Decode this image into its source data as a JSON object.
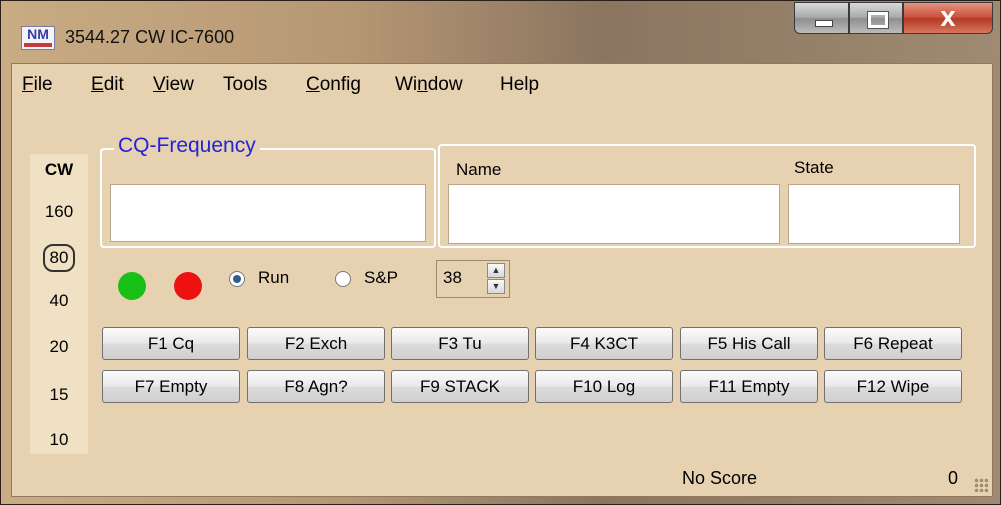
{
  "window": {
    "title": "3544.27 CW IC-7600",
    "app_icon_text": "NM",
    "controls": {
      "minimize": "minimize",
      "maximize": "maximize",
      "close": "X"
    }
  },
  "menu": [
    "File",
    "Edit",
    "View",
    "Tools",
    "Config",
    "Window",
    "Help"
  ],
  "bands": {
    "mode": "CW",
    "items": [
      "160",
      "80",
      "40",
      "20",
      "15",
      "10"
    ],
    "selected": "80"
  },
  "cq_frequency": {
    "legend": "CQ-Frequency",
    "value": ""
  },
  "name_field": {
    "label": "Name",
    "value": ""
  },
  "state_field": {
    "label": "State",
    "value": ""
  },
  "indicators": {
    "green": "#18c018",
    "red": "#ee1111"
  },
  "mode_radio": {
    "run_label": "Run",
    "sp_label": "S&P",
    "selected": "Run"
  },
  "spinner": {
    "value": "38"
  },
  "fkeys": [
    [
      "F1 Cq",
      "F2 Exch",
      "F3 Tu",
      "F4 K3CT",
      "F5 His Call",
      "F6 Repeat"
    ],
    [
      "F7 Empty",
      "F8 Agn?",
      "F9 STACK",
      "F10 Log",
      "F11 Empty",
      "F12 Wipe"
    ]
  ],
  "status": {
    "score": "No Score",
    "count": "0"
  }
}
